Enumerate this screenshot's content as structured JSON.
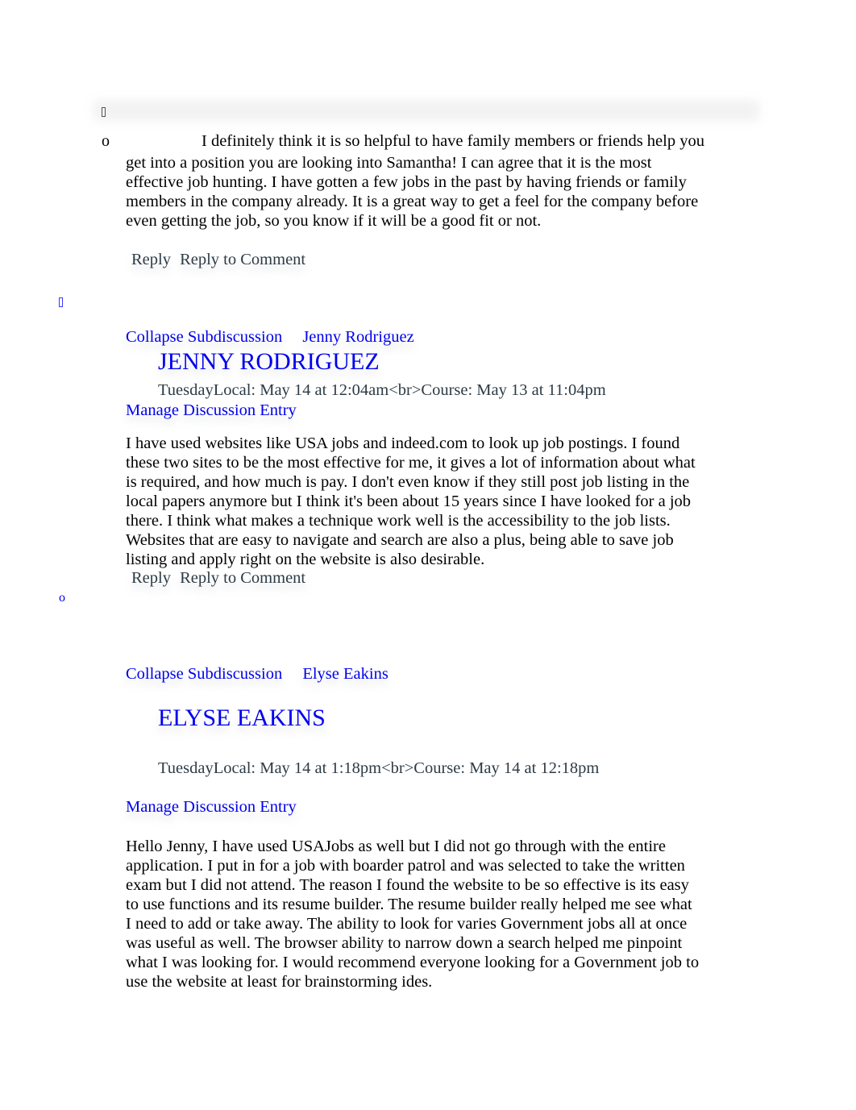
{
  "top": {
    "collapsed_icon": "missing-glyph-icon",
    "bullet": "o"
  },
  "first_reply": {
    "body_line1": "I definitely think it is so helpful to have family members or friends help you",
    "body_rest": "get into a position you are looking into Samantha! I can agree that it is the most effective job hunting. I have gotten a few jobs in the past by having friends or family members in the company already. It is a great way to get a feel for the company before even getting the job, so you know if it will be a good fit or not.",
    "actions": {
      "reply": "Reply",
      "reply_to_comment": "Reply to Comment"
    }
  },
  "entries": [
    {
      "list_icon": "missing-glyph-icon",
      "collapse_label": "Collapse Subdiscussion",
      "author_link": "Jenny Rodriguez",
      "author_heading": "JENNY RODRIGUEZ",
      "timestamp": "TuesdayLocal: May 14 at 12:04am<br>Course: May 13 at 11:04pm",
      "manage_label": "Manage Discussion Entry",
      "body": "I have used websites like USA jobs and indeed.com to look up job postings. I found these two sites to be the most effective for me, it gives a lot of information about what is required, and how much is pay. I don't even know if they still post job listing in the local papers anymore but I think it's been about 15 years since I have looked for a job there. I think what makes a technique work well is the accessibility to the job lists. Websites that are easy to navigate and search are also a plus, being able to save job listing and apply right on the website is also desirable.",
      "actions": {
        "reply": "Reply",
        "reply_to_comment": "Reply to Comment"
      }
    },
    {
      "list_icon": "o",
      "collapse_label": "Collapse Subdiscussion",
      "author_link": "Elyse Eakins",
      "author_heading": "ELYSE EAKINS",
      "timestamp": "TuesdayLocal: May 14 at 1:18pm<br>Course: May 14 at 12:18pm",
      "manage_label": "Manage Discussion Entry",
      "body": "Hello Jenny, I have used USAJobs as well but I did not go through with the entire application. I put in for a job with boarder patrol and was selected to take the written exam but I did not attend. The reason I found the website to be so effective is its easy to use functions and its resume builder. The resume builder really helped me see what I need to add or take away. The ability to look for varies Government jobs all at once was useful as well. The browser ability to narrow down a search helped me pinpoint what I was looking for. I would recommend everyone looking for a Government job to use the website at least for brainstorming ides."
    }
  ]
}
